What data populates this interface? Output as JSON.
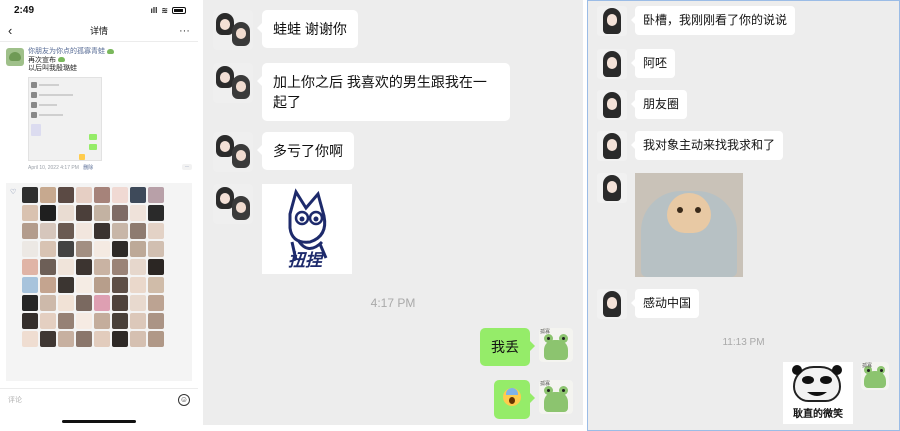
{
  "panel1": {
    "status": {
      "time": "2:49"
    },
    "nav": {
      "back": "‹",
      "title": "详情",
      "more": "···"
    },
    "post": {
      "author": "你朋友为你点的孤寡青蛙",
      "line1": "再次宣布",
      "line2": "以后叫我殷璐蛙",
      "date": "April 10, 2022 4:17 PM",
      "delete": "删除",
      "more_dots": "··"
    },
    "comment_placeholder": "评论",
    "emoji_icon": "☺",
    "like_colors": [
      "#2f2f2f",
      "#c7a98f",
      "#5b4a44",
      "#e6cfc4",
      "#a6837a",
      "#f0d9d3",
      "#3e4a5a",
      "#b8a0a8",
      "#d9c2b0",
      "#1f1f1f",
      "#e9dcd2",
      "#4b3f3a",
      "#c3b2a2",
      "#7e6b66",
      "#efe2da",
      "#2a2a2a",
      "#b39c8c",
      "#d6c6bc",
      "#6a5a52",
      "#f2e6de",
      "#3a3330",
      "#c8b6a8",
      "#8e7b70",
      "#e3d2c6",
      "#ece8e4",
      "#d8c3b3",
      "#434343",
      "#a28f82",
      "#f4eae2",
      "#2d2a28",
      "#bda998",
      "#d1bfb1",
      "#e0b4a6",
      "#6d5f57",
      "#f0e4da",
      "#3c3430",
      "#c9b3a3",
      "#9a8377",
      "#e6d7cc",
      "#2b2623",
      "#a7c3dc",
      "#c4a48f",
      "#3b3531",
      "#f5ece4",
      "#b79e8b",
      "#5e4f47",
      "#ead8cb",
      "#d0bca9",
      "#262626",
      "#cdb9aa",
      "#f1e2d6",
      "#7a6960",
      "#de9fb2",
      "#4f433c",
      "#e8d9ce",
      "#bca392",
      "#352f2c",
      "#e4cfc1",
      "#968175",
      "#f6ebe3",
      "#c4ad9c",
      "#494039",
      "#dcc8ba",
      "#ab9485",
      "#efddd1",
      "#3f3733",
      "#c7b0a0",
      "#8a766b",
      "#e2ccbd",
      "#2e2926",
      "#d5c0b1",
      "#b09887"
    ]
  },
  "panel2": {
    "messages": [
      {
        "text": "蛙蛙 谢谢你"
      },
      {
        "text": "加上你之后 我喜欢的男生跟我在一起了"
      },
      {
        "text": "多亏了你啊"
      }
    ],
    "sticker_text": "扭捏",
    "timestamp": "4:17 PM",
    "reply1": "我丢",
    "frog_label": "孤寡"
  },
  "panel3": {
    "messages": [
      {
        "text": "卧槽，我刚刚看了你的说说"
      },
      {
        "text": "阿呸"
      },
      {
        "text": "朋友圈"
      },
      {
        "text": "我对象主动来找我求和了"
      }
    ],
    "after_photo": "感动中国",
    "timestamp": "11:13 PM",
    "sticker_caption": "耿直的微笑",
    "frog_label": "孤寡"
  }
}
